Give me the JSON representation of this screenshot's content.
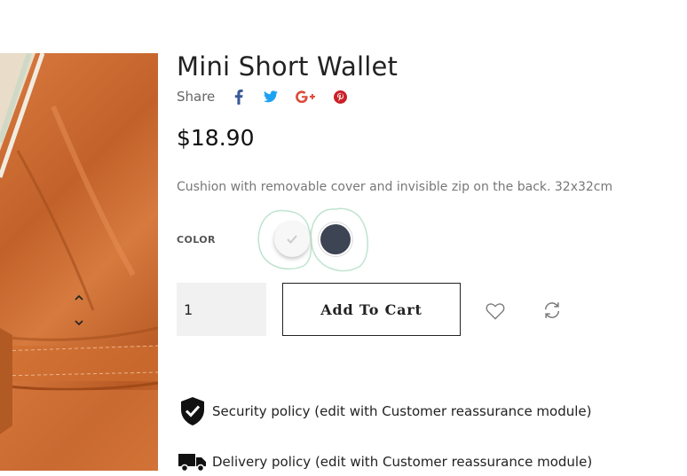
{
  "product": {
    "title": "Mini Short Wallet",
    "price": "$18.90",
    "description": "Cushion with removable cover and invisible zip on the back. 32x32cm"
  },
  "share": {
    "label": "Share",
    "icons": [
      "facebook-icon",
      "twitter-icon",
      "google-plus-icon",
      "pinterest-icon"
    ],
    "colors": {
      "facebook": "#3b5998",
      "twitter": "#1da1f2",
      "google_plus": "#dd4b39",
      "pinterest": "#cb2027"
    }
  },
  "color_selector": {
    "label": "COLOR",
    "swatches": [
      {
        "name": "White",
        "hex": "#f7f7f7",
        "selected": true
      },
      {
        "name": "Dark grey",
        "hex": "#3d4453",
        "selected": false
      }
    ]
  },
  "quantity": {
    "value": "1"
  },
  "cart": {
    "add_label": "Add To Cart"
  },
  "actions": [
    "heart-icon",
    "refresh-icon"
  ],
  "reassurance": [
    {
      "icon": "shield-check-icon",
      "text": "Security policy (edit with Customer reassurance module)"
    },
    {
      "icon": "truck-icon",
      "text": "Delivery policy (edit with Customer reassurance module)"
    }
  ]
}
